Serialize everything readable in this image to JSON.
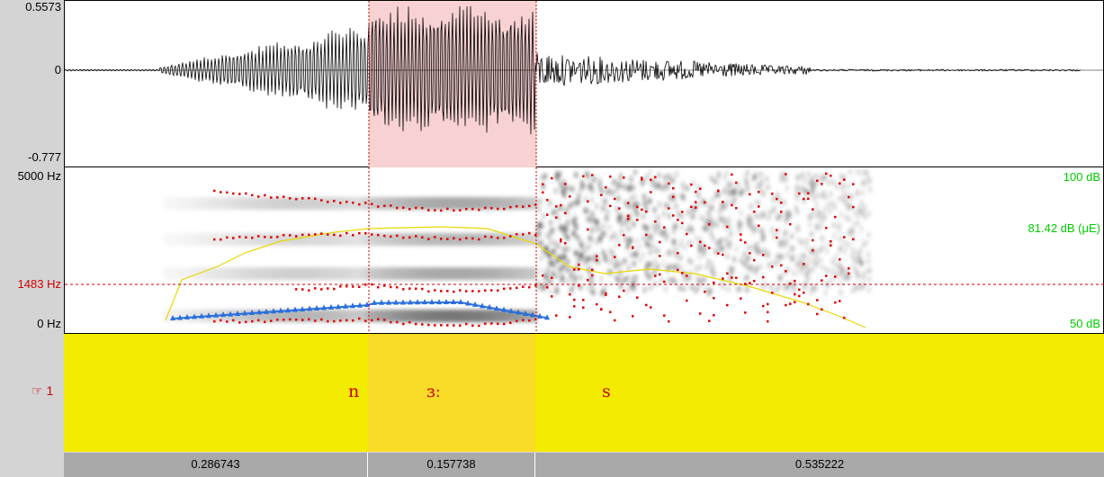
{
  "waveform": {
    "y_max_label": "0.5573",
    "y_zero_label": "0",
    "y_min_label": "-0.777"
  },
  "spectrogram": {
    "freq_top_label": "5000 Hz",
    "freq_cursor_label": "1483 Hz",
    "freq_bottom_label": "0 Hz",
    "intensity_top_label": "100 dB",
    "intensity_mid_label": "81.42 dB (μE)",
    "intensity_bottom_label": "50 dB"
  },
  "tier": {
    "name": "☞ 1",
    "segments": [
      {
        "label": "n",
        "duration": "0.286743"
      },
      {
        "label": "ɜː",
        "duration": "0.157738"
      },
      {
        "label": "s",
        "duration": "0.535222"
      }
    ]
  },
  "colors": {
    "selection": "#f8d2d2",
    "tier_background": "#f4ec00",
    "tier_selected": "#f8dc28",
    "pitch": "#2a6fdc",
    "formant": "#e00000",
    "intensity": "#e8d800"
  }
}
